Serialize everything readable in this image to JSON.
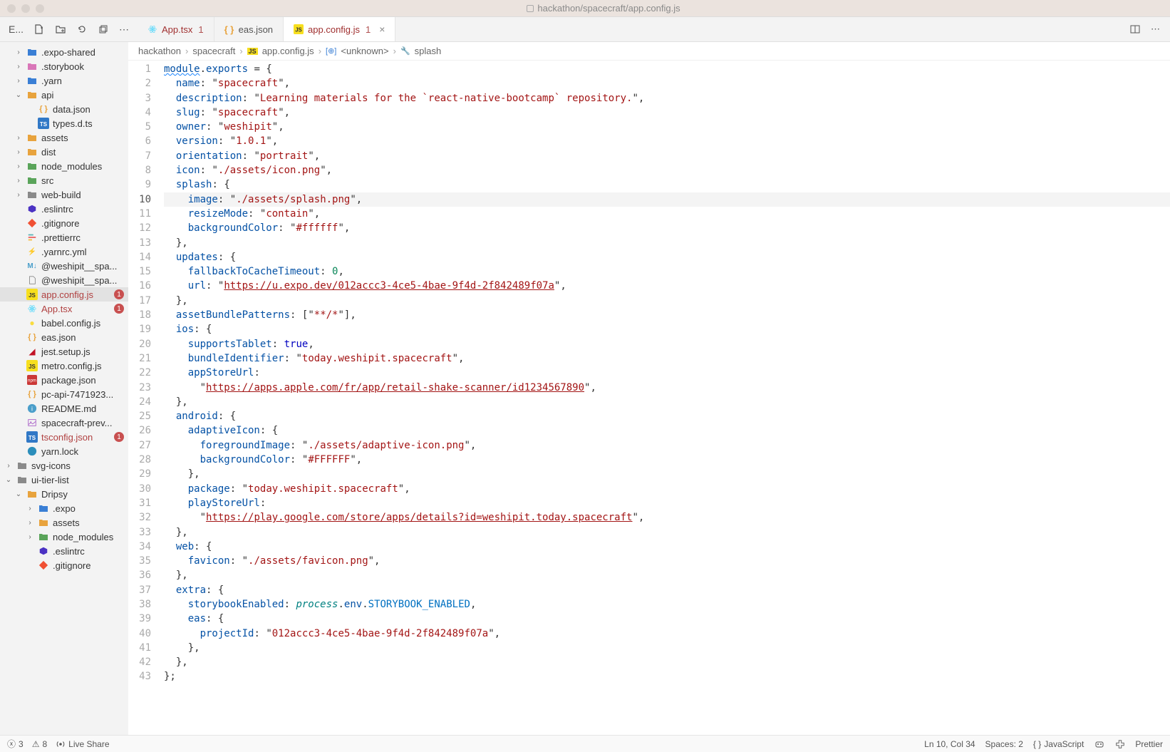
{
  "window": {
    "title": "hackathon/spacecraft/app.config.js"
  },
  "tabs": [
    {
      "label": "App.tsx",
      "dirty": "1",
      "icon": "react",
      "active": false,
      "labelColor": "error"
    },
    {
      "label": "eas.json",
      "dirty": "",
      "icon": "braces",
      "active": false,
      "labelColor": "neutral"
    },
    {
      "label": "app.config.js",
      "dirty": "1",
      "icon": "js",
      "active": true,
      "labelColor": "error"
    }
  ],
  "activity": {
    "label": "E..."
  },
  "sidebar": {
    "items": [
      {
        "depth": 1,
        "chev": "›",
        "icon": "folder-blue",
        "name": ".expo-shared"
      },
      {
        "depth": 1,
        "chev": "›",
        "icon": "folder-pink",
        "name": ".storybook"
      },
      {
        "depth": 1,
        "chev": "›",
        "icon": "folder-blue",
        "name": ".yarn"
      },
      {
        "depth": 1,
        "chev": "⌄",
        "icon": "folder-yellow",
        "name": "api",
        "open": true
      },
      {
        "depth": 2,
        "chev": "",
        "icon": "json",
        "name": "data.json"
      },
      {
        "depth": 2,
        "chev": "",
        "icon": "ts",
        "name": "types.d.ts"
      },
      {
        "depth": 1,
        "chev": "›",
        "icon": "folder-yellow",
        "name": "assets"
      },
      {
        "depth": 1,
        "chev": "›",
        "icon": "folder-yellow",
        "name": "dist"
      },
      {
        "depth": 1,
        "chev": "›",
        "icon": "folder-green",
        "name": "node_modules"
      },
      {
        "depth": 1,
        "chev": "›",
        "icon": "folder-green",
        "name": "src"
      },
      {
        "depth": 1,
        "chev": "›",
        "icon": "folder-gray",
        "name": "web-build"
      },
      {
        "depth": 1,
        "chev": "",
        "icon": "eslint",
        "name": ".eslintrc"
      },
      {
        "depth": 1,
        "chev": "",
        "icon": "git",
        "name": ".gitignore"
      },
      {
        "depth": 1,
        "chev": "",
        "icon": "prettier",
        "name": ".prettierrc"
      },
      {
        "depth": 1,
        "chev": "",
        "icon": "yaml",
        "name": ".yarnrc.yml"
      },
      {
        "depth": 1,
        "chev": "",
        "icon": "md",
        "name": "@weshipit__spa..."
      },
      {
        "depth": 1,
        "chev": "",
        "icon": "file",
        "name": "@weshipit__spa..."
      },
      {
        "depth": 1,
        "chev": "",
        "icon": "js",
        "name": "app.config.js",
        "error": true,
        "badge": "1",
        "selected": true
      },
      {
        "depth": 1,
        "chev": "",
        "icon": "react",
        "name": "App.tsx",
        "error": true,
        "badge": "1"
      },
      {
        "depth": 1,
        "chev": "",
        "icon": "babel",
        "name": "babel.config.js"
      },
      {
        "depth": 1,
        "chev": "",
        "icon": "json",
        "name": "eas.json"
      },
      {
        "depth": 1,
        "chev": "",
        "icon": "jest",
        "name": "jest.setup.js"
      },
      {
        "depth": 1,
        "chev": "",
        "icon": "js",
        "name": "metro.config.js"
      },
      {
        "depth": 1,
        "chev": "",
        "icon": "npm",
        "name": "package.json"
      },
      {
        "depth": 1,
        "chev": "",
        "icon": "json",
        "name": "pc-api-7471923..."
      },
      {
        "depth": 1,
        "chev": "",
        "icon": "info",
        "name": "README.md"
      },
      {
        "depth": 1,
        "chev": "",
        "icon": "image",
        "name": "spacecraft-prev..."
      },
      {
        "depth": 1,
        "chev": "",
        "icon": "ts",
        "name": "tsconfig.json",
        "error": true,
        "badge": "1"
      },
      {
        "depth": 1,
        "chev": "",
        "icon": "yarn",
        "name": "yarn.lock"
      },
      {
        "depth": 0,
        "chev": "›",
        "icon": "folder-gray",
        "name": "svg-icons"
      },
      {
        "depth": 0,
        "chev": "⌄",
        "icon": "folder-gray",
        "name": "ui-tier-list",
        "open": true
      },
      {
        "depth": 1,
        "chev": "⌄",
        "icon": "folder-yellow",
        "name": "Dripsy",
        "open": true
      },
      {
        "depth": 2,
        "chev": "›",
        "icon": "folder-blue",
        "name": ".expo"
      },
      {
        "depth": 2,
        "chev": "›",
        "icon": "folder-yellow",
        "name": "assets"
      },
      {
        "depth": 2,
        "chev": "›",
        "icon": "folder-green",
        "name": "node_modules"
      },
      {
        "depth": 2,
        "chev": "",
        "icon": "eslint",
        "name": ".eslintrc"
      },
      {
        "depth": 2,
        "chev": "",
        "icon": "git",
        "name": ".gitignore"
      }
    ]
  },
  "breadcrumb": [
    {
      "text": "hackathon",
      "icon": ""
    },
    {
      "text": "spacecraft",
      "icon": ""
    },
    {
      "text": "app.config.js",
      "icon": "js"
    },
    {
      "text": "<unknown>",
      "icon": "module"
    },
    {
      "text": "splash",
      "icon": "wrench"
    }
  ],
  "code": {
    "lines": 43,
    "currentLine": 10
  },
  "statusbar": {
    "errors": "3",
    "warnings": "8",
    "liveshare": "Live Share",
    "position": "Ln 10, Col 34",
    "spaces": "Spaces: 2",
    "lang": "JavaScript",
    "langIcon": "{ }",
    "prettier": "Prettier"
  }
}
